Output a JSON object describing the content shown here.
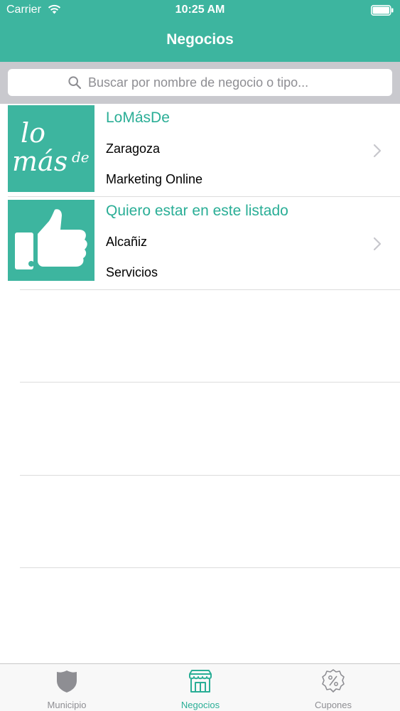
{
  "status_bar": {
    "carrier": "Carrier",
    "time": "10:25 AM"
  },
  "nav": {
    "title": "Negocios"
  },
  "search": {
    "placeholder": "Buscar por nombre de negocio o tipo..."
  },
  "businesses": [
    {
      "logo_text": "lo más de",
      "name": "LoMásDe",
      "city": "Zaragoza",
      "category": "Marketing Online"
    },
    {
      "logo_text": "",
      "name": "Quiero estar en este listado",
      "city": "Alcañiz",
      "category": "Servicios"
    }
  ],
  "tabbar": {
    "tabs": [
      {
        "label": "Municipio",
        "icon": "shield-icon",
        "active": false
      },
      {
        "label": "Negocios",
        "icon": "store-icon",
        "active": true
      },
      {
        "label": "Cupones",
        "icon": "percent-badge-icon",
        "active": false
      }
    ]
  },
  "colors": {
    "accent": "#3db59f",
    "accent_text": "#2aae96",
    "inactive": "#8e8e93"
  }
}
